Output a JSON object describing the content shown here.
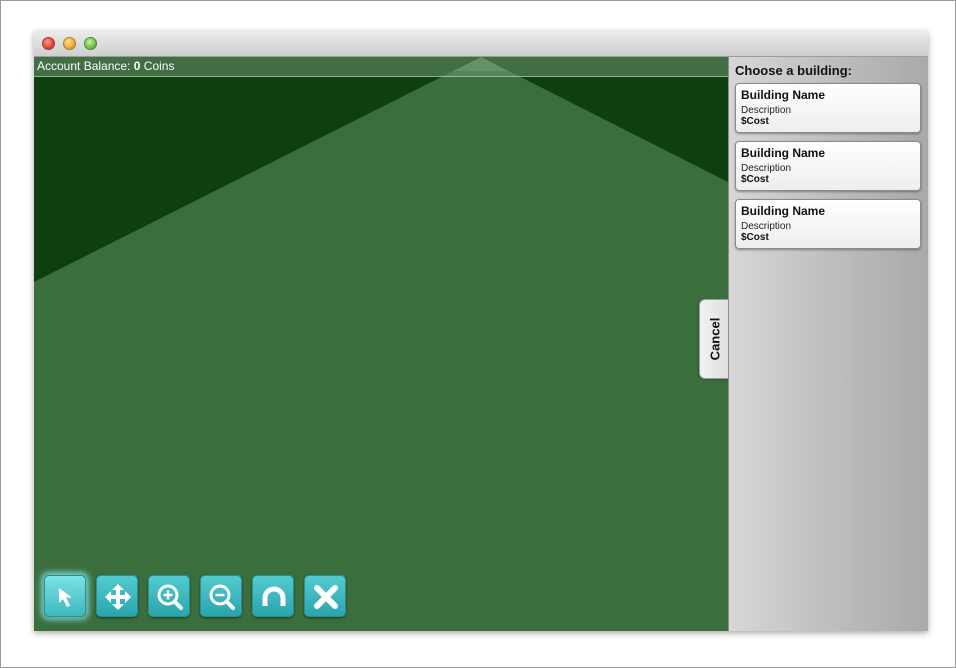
{
  "balance": {
    "label": "Account Balance:",
    "amount": "0",
    "unit": "Coins"
  },
  "sidebar": {
    "title": "Choose a building:",
    "buildings": [
      {
        "name": "Building Name",
        "description": "Description",
        "cost": "$Cost"
      },
      {
        "name": "Building Name",
        "description": "Description",
        "cost": "$Cost"
      },
      {
        "name": "Building Name",
        "description": "Description",
        "cost": "$Cost"
      }
    ]
  },
  "cancel_tab": {
    "label": "Cancel"
  },
  "toolbar": {
    "tools": [
      {
        "icon": "select-arrow-icon",
        "active": true
      },
      {
        "icon": "move-icon",
        "active": false
      },
      {
        "icon": "zoom-in-icon",
        "active": false
      },
      {
        "icon": "zoom-out-icon",
        "active": false
      },
      {
        "icon": "rotate-icon",
        "active": false
      },
      {
        "icon": "close-icon",
        "active": false
      }
    ]
  },
  "colors": {
    "ground_dark": "#0e3f10",
    "ground_light": "#3b6e3d",
    "tool_accent": "#3dbac0",
    "sidebar_bg": "#c4c4c4"
  }
}
